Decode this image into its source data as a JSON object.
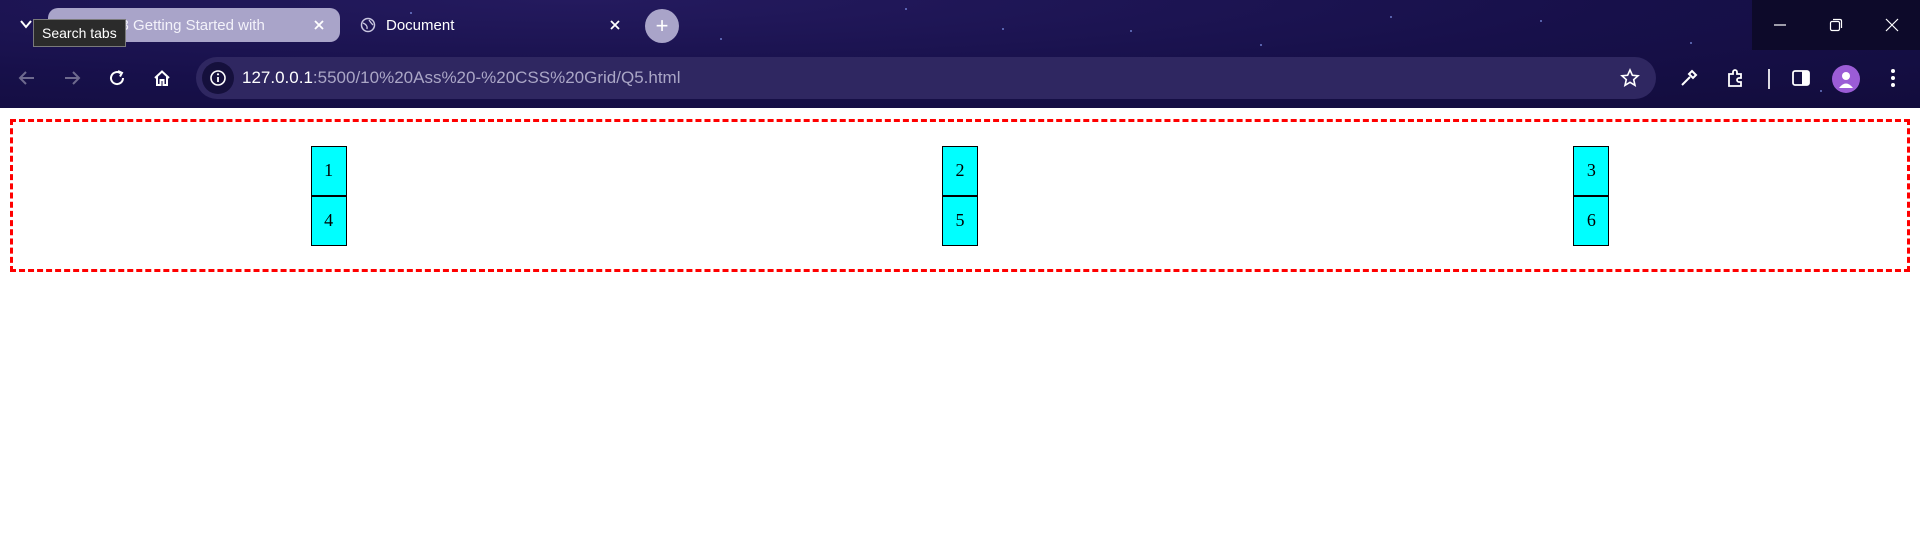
{
  "browser": {
    "tabs": [
      {
        "title": "Git^23 Getting Started with",
        "active": true
      },
      {
        "title": "Document",
        "active": false
      }
    ],
    "tooltip": "Search tabs",
    "new_tab_label": "+",
    "address": {
      "host": "127.0.0.1",
      "path": ":5500/10%20Ass%20-%20CSS%20Grid/Q5.html"
    },
    "colors": {
      "frame": "#17104a",
      "omnibox": "#2f2761",
      "active_tab": "#a9a4c9"
    }
  },
  "page": {
    "grid_items": [
      "1",
      "2",
      "3",
      "4",
      "5",
      "6"
    ],
    "colors": {
      "container_border": "#ff0000",
      "item_background": "#00ffff",
      "item_border": "#000000"
    }
  }
}
